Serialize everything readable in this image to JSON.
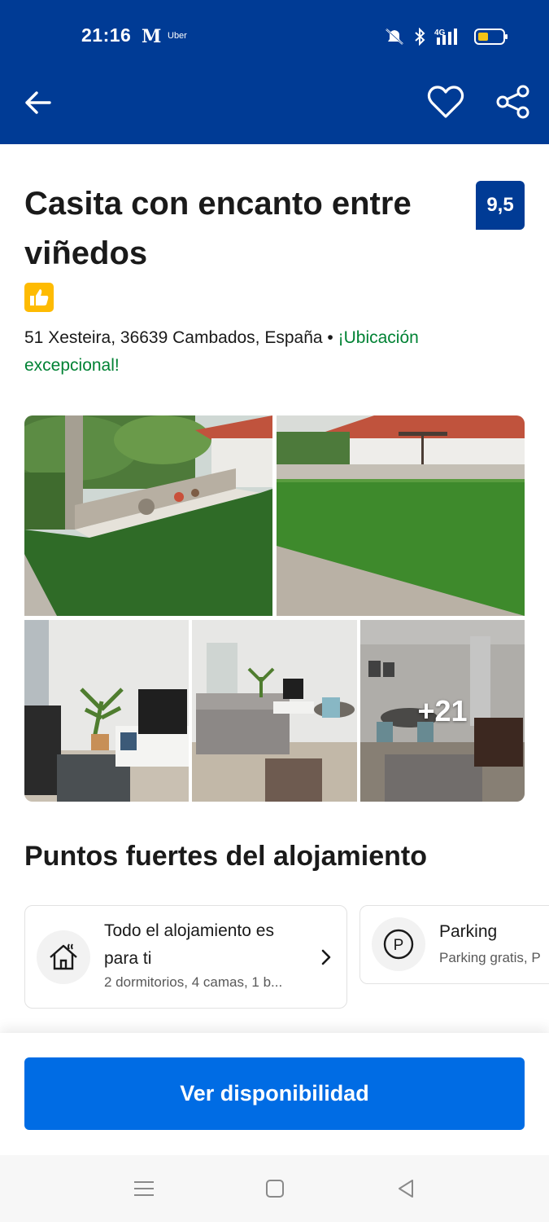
{
  "status_bar": {
    "time": "21:16",
    "app_m": "M",
    "app_uber": "Uber",
    "network": "4G"
  },
  "header": {
    "icons": [
      "arrow-left-icon",
      "heart-icon",
      "share-icon"
    ],
    "background_color": "#003b95"
  },
  "property": {
    "title": "Casita con encanto entre viñedos",
    "score": "9,5",
    "address": "51 Xesteira, 36639 Cambados, España",
    "separator": " • ",
    "location_badge": "¡Ubicación excepcional!"
  },
  "gallery": {
    "more_count": "+21"
  },
  "highlights": {
    "title": "Puntos fuertes del alojamiento",
    "cards": [
      {
        "icon": "house-icon",
        "title": "Todo el alojamiento es para ti",
        "subtitle": "2 dormitorios, 4 camas, 1 b..."
      },
      {
        "icon": "parking-icon",
        "icon_letter": "P",
        "title": "Parking",
        "subtitle": "Parking gratis, P"
      }
    ]
  },
  "cta": {
    "label": "Ver disponibilidad",
    "color": "#006ce4"
  },
  "colors": {
    "primary": "#003b95",
    "accent": "#006ce4",
    "location": "#008234",
    "genius": "#febb02"
  }
}
